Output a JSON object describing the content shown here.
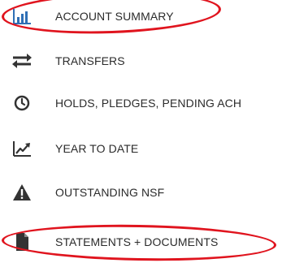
{
  "menu": {
    "items": [
      {
        "label": "ACCOUNT SUMMARY",
        "icon": "bar-chart-icon"
      },
      {
        "label": "TRANSFERS",
        "icon": "transfer-arrows-icon"
      },
      {
        "label": "HOLDS, PLEDGES, PENDING ACH",
        "icon": "clock-icon"
      },
      {
        "label": "YEAR TO DATE",
        "icon": "trending-up-icon"
      },
      {
        "label": "OUTSTANDING NSF",
        "icon": "warning-icon"
      },
      {
        "label": "STATEMENTS + DOCUMENTS",
        "icon": "document-icon"
      }
    ]
  },
  "colors": {
    "text": "#2b2b2b",
    "icon_dark": "#333333",
    "icon_blue": "#2f6fb5",
    "annotation_red": "#e0141e"
  },
  "annotations": {
    "circled_items": [
      "ACCOUNT SUMMARY",
      "STATEMENTS + DOCUMENTS"
    ]
  }
}
